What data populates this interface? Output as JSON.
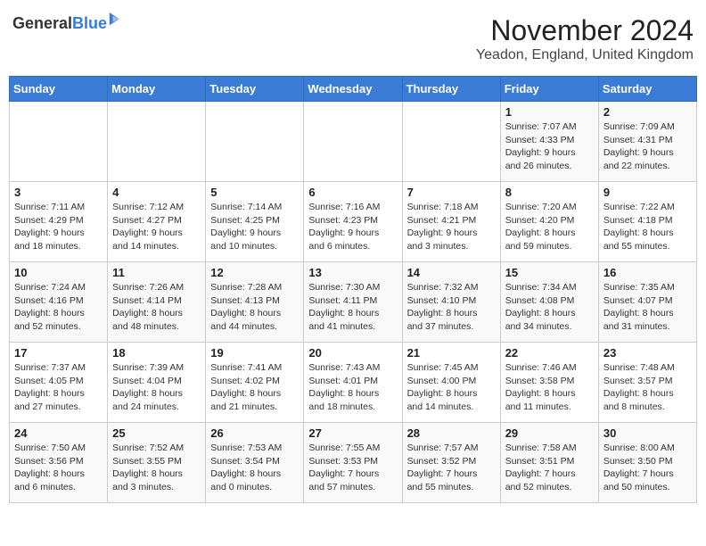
{
  "logo": {
    "general": "General",
    "blue": "Blue"
  },
  "title": "November 2024",
  "location": "Yeadon, England, United Kingdom",
  "days_header": [
    "Sunday",
    "Monday",
    "Tuesday",
    "Wednesday",
    "Thursday",
    "Friday",
    "Saturday"
  ],
  "weeks": [
    [
      {
        "day": "",
        "info": ""
      },
      {
        "day": "",
        "info": ""
      },
      {
        "day": "",
        "info": ""
      },
      {
        "day": "",
        "info": ""
      },
      {
        "day": "",
        "info": ""
      },
      {
        "day": "1",
        "info": "Sunrise: 7:07 AM\nSunset: 4:33 PM\nDaylight: 9 hours\nand 26 minutes."
      },
      {
        "day": "2",
        "info": "Sunrise: 7:09 AM\nSunset: 4:31 PM\nDaylight: 9 hours\nand 22 minutes."
      }
    ],
    [
      {
        "day": "3",
        "info": "Sunrise: 7:11 AM\nSunset: 4:29 PM\nDaylight: 9 hours\nand 18 minutes."
      },
      {
        "day": "4",
        "info": "Sunrise: 7:12 AM\nSunset: 4:27 PM\nDaylight: 9 hours\nand 14 minutes."
      },
      {
        "day": "5",
        "info": "Sunrise: 7:14 AM\nSunset: 4:25 PM\nDaylight: 9 hours\nand 10 minutes."
      },
      {
        "day": "6",
        "info": "Sunrise: 7:16 AM\nSunset: 4:23 PM\nDaylight: 9 hours\nand 6 minutes."
      },
      {
        "day": "7",
        "info": "Sunrise: 7:18 AM\nSunset: 4:21 PM\nDaylight: 9 hours\nand 3 minutes."
      },
      {
        "day": "8",
        "info": "Sunrise: 7:20 AM\nSunset: 4:20 PM\nDaylight: 8 hours\nand 59 minutes."
      },
      {
        "day": "9",
        "info": "Sunrise: 7:22 AM\nSunset: 4:18 PM\nDaylight: 8 hours\nand 55 minutes."
      }
    ],
    [
      {
        "day": "10",
        "info": "Sunrise: 7:24 AM\nSunset: 4:16 PM\nDaylight: 8 hours\nand 52 minutes."
      },
      {
        "day": "11",
        "info": "Sunrise: 7:26 AM\nSunset: 4:14 PM\nDaylight: 8 hours\nand 48 minutes."
      },
      {
        "day": "12",
        "info": "Sunrise: 7:28 AM\nSunset: 4:13 PM\nDaylight: 8 hours\nand 44 minutes."
      },
      {
        "day": "13",
        "info": "Sunrise: 7:30 AM\nSunset: 4:11 PM\nDaylight: 8 hours\nand 41 minutes."
      },
      {
        "day": "14",
        "info": "Sunrise: 7:32 AM\nSunset: 4:10 PM\nDaylight: 8 hours\nand 37 minutes."
      },
      {
        "day": "15",
        "info": "Sunrise: 7:34 AM\nSunset: 4:08 PM\nDaylight: 8 hours\nand 34 minutes."
      },
      {
        "day": "16",
        "info": "Sunrise: 7:35 AM\nSunset: 4:07 PM\nDaylight: 8 hours\nand 31 minutes."
      }
    ],
    [
      {
        "day": "17",
        "info": "Sunrise: 7:37 AM\nSunset: 4:05 PM\nDaylight: 8 hours\nand 27 minutes."
      },
      {
        "day": "18",
        "info": "Sunrise: 7:39 AM\nSunset: 4:04 PM\nDaylight: 8 hours\nand 24 minutes."
      },
      {
        "day": "19",
        "info": "Sunrise: 7:41 AM\nSunset: 4:02 PM\nDaylight: 8 hours\nand 21 minutes."
      },
      {
        "day": "20",
        "info": "Sunrise: 7:43 AM\nSunset: 4:01 PM\nDaylight: 8 hours\nand 18 minutes."
      },
      {
        "day": "21",
        "info": "Sunrise: 7:45 AM\nSunset: 4:00 PM\nDaylight: 8 hours\nand 14 minutes."
      },
      {
        "day": "22",
        "info": "Sunrise: 7:46 AM\nSunset: 3:58 PM\nDaylight: 8 hours\nand 11 minutes."
      },
      {
        "day": "23",
        "info": "Sunrise: 7:48 AM\nSunset: 3:57 PM\nDaylight: 8 hours\nand 8 minutes."
      }
    ],
    [
      {
        "day": "24",
        "info": "Sunrise: 7:50 AM\nSunset: 3:56 PM\nDaylight: 8 hours\nand 6 minutes."
      },
      {
        "day": "25",
        "info": "Sunrise: 7:52 AM\nSunset: 3:55 PM\nDaylight: 8 hours\nand 3 minutes."
      },
      {
        "day": "26",
        "info": "Sunrise: 7:53 AM\nSunset: 3:54 PM\nDaylight: 8 hours\nand 0 minutes."
      },
      {
        "day": "27",
        "info": "Sunrise: 7:55 AM\nSunset: 3:53 PM\nDaylight: 7 hours\nand 57 minutes."
      },
      {
        "day": "28",
        "info": "Sunrise: 7:57 AM\nSunset: 3:52 PM\nDaylight: 7 hours\nand 55 minutes."
      },
      {
        "day": "29",
        "info": "Sunrise: 7:58 AM\nSunset: 3:51 PM\nDaylight: 7 hours\nand 52 minutes."
      },
      {
        "day": "30",
        "info": "Sunrise: 8:00 AM\nSunset: 3:50 PM\nDaylight: 7 hours\nand 50 minutes."
      }
    ]
  ]
}
